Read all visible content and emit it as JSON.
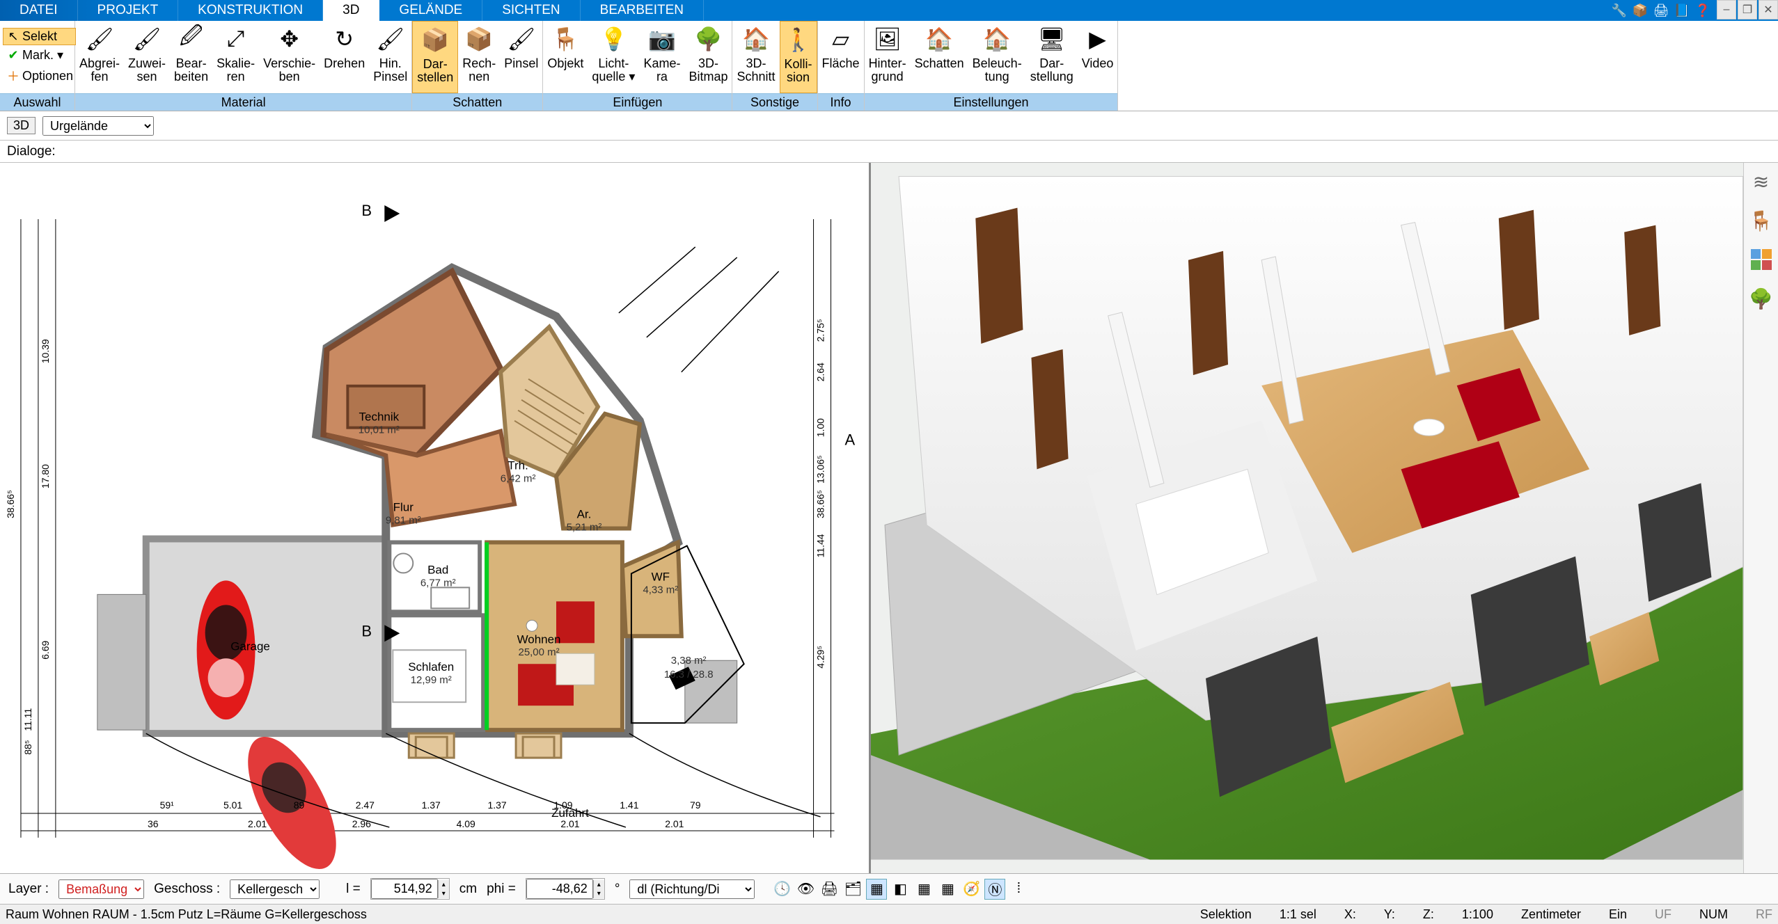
{
  "menu": {
    "tabs": [
      "DATEI",
      "PROJEKT",
      "KONSTRUKTION",
      "3D",
      "GELÄNDE",
      "SICHTEN",
      "BEARBEITEN"
    ],
    "active": "3D"
  },
  "win_icons": [
    "🔧",
    "📦",
    "🖨",
    "📘",
    "❓"
  ],
  "ribbon": {
    "auswahl": {
      "label": "Auswahl",
      "items": [
        {
          "icon": "↖",
          "text": "Selekt",
          "sel": true
        },
        {
          "icon": "✔",
          "text": "Mark. ▾",
          "sel": false
        },
        {
          "icon": "＋",
          "text": "Optionen",
          "sel": false
        }
      ]
    },
    "groups": [
      {
        "label": "Material",
        "buttons": [
          {
            "icon": "🖌",
            "t": "Abgrei-\nfen"
          },
          {
            "icon": "🖌",
            "t": "Zuwei-\nsen"
          },
          {
            "icon": "🖉",
            "t": "Bear-\nbeiten"
          },
          {
            "icon": "⤢",
            "t": "Skalie-\nren"
          },
          {
            "icon": "✥",
            "t": "Verschie-\nben"
          },
          {
            "icon": "↻",
            "t": "Drehen"
          },
          {
            "icon": "🖌",
            "t": "Hin.\nPinsel"
          }
        ]
      },
      {
        "label": "Schatten",
        "buttons": [
          {
            "icon": "📦",
            "t": "Dar-\nstellen",
            "hl": true
          },
          {
            "icon": "📦",
            "t": "Rech-\nnen"
          },
          {
            "icon": "🖌",
            "t": "Pinsel"
          }
        ]
      },
      {
        "label": "Einfügen",
        "buttons": [
          {
            "icon": "🪑",
            "t": "Objekt"
          },
          {
            "icon": "💡",
            "t": "Licht-\nquelle ▾"
          },
          {
            "icon": "📷",
            "t": "Kame-\nra"
          },
          {
            "icon": "🌳",
            "t": "3D-\nBitmap"
          }
        ]
      },
      {
        "label": "Sonstige",
        "buttons": [
          {
            "icon": "🏠",
            "t": "3D-\nSchnitt"
          },
          {
            "icon": "🚶",
            "t": "Kolli-\nsion",
            "hl": true
          }
        ]
      },
      {
        "label": "Info",
        "buttons": [
          {
            "icon": "▱",
            "t": "Fläche"
          }
        ]
      },
      {
        "label": "Einstellungen",
        "buttons": [
          {
            "icon": "🖼",
            "t": "Hinter-\ngrund"
          },
          {
            "icon": "🏠",
            "t": "Schatten"
          },
          {
            "icon": "🏠",
            "t": "Beleuch-\ntung"
          },
          {
            "icon": "🖥",
            "t": "Dar-\nstellung"
          },
          {
            "icon": "▶",
            "t": "Video"
          }
        ]
      }
    ]
  },
  "subbar": {
    "mode": "3D",
    "layer": "Urgelände"
  },
  "dialoge_label": "Dialoge:",
  "plan": {
    "rooms": [
      {
        "name": "Technik",
        "area": "10,01 m²"
      },
      {
        "name": "Flur",
        "area": "9,81 m²"
      },
      {
        "name": "Trh.",
        "area": "6,42 m²"
      },
      {
        "name": "Ar.",
        "area": "5,21 m²"
      },
      {
        "name": "Bad",
        "area": "6,77 m²"
      },
      {
        "name": "WF",
        "area": "4,33 m²"
      },
      {
        "name": "Wohnen",
        "area": "25,00 m²"
      },
      {
        "name": "Schlafen",
        "area": "12,99 m²"
      },
      {
        "name": "Garage",
        "area": ""
      },
      {
        "name": "Zufahrt",
        "area": ""
      }
    ],
    "terrain_area": "3,38 m²",
    "terrain_note": "16.3 / 28.8",
    "dims_h": [
      "59¹",
      "5.01",
      "89",
      "2.47",
      "1.37",
      "1.37",
      "1.09",
      "1.41",
      "79"
    ],
    "dims_h2": [
      "36",
      "2.01",
      "2.96",
      "4.09",
      "2.01",
      "2.01"
    ],
    "dims_v_left": [
      "17.80",
      "10.39",
      "6.69",
      "11.11",
      "88⁵",
      "38.66⁵"
    ],
    "dims_v_right": [
      "2.75⁵",
      "2.64",
      "1.00",
      "13.06⁵",
      "11.44",
      "4.29⁵",
      "38.66⁵"
    ]
  },
  "bottom": {
    "layer_label": "Layer :",
    "layer_value": "Bemaßung",
    "geschoss_label": "Geschoss :",
    "geschoss_value": "Kellergesch",
    "l_label": "l =",
    "l_value": "514,92",
    "l_unit": "cm",
    "phi_label": "phi =",
    "phi_value": "-48,62",
    "phi_unit": "°",
    "dl_placeholder": "dl (Richtung/Di",
    "mini": [
      "🕓",
      "👁",
      "🖨",
      "🗂",
      "▦",
      "◧",
      "▦",
      "▦",
      "🧭",
      "Ⓝ",
      "⁞"
    ]
  },
  "status": {
    "left": "Raum Wohnen RAUM - 1.5cm Putz L=Räume G=Kellergeschoss",
    "selektion": "Selektion",
    "sel_ratio": "1:1 sel",
    "x": "X:",
    "y": "Y:",
    "z": "Z:",
    "scale": "1:100",
    "unit": "Zentimeter",
    "ein": "Ein",
    "uf": "UF",
    "num": "NUM",
    "rf": "RF"
  },
  "colors": {
    "accent": "#0078d0",
    "highlight": "#ffd880"
  }
}
